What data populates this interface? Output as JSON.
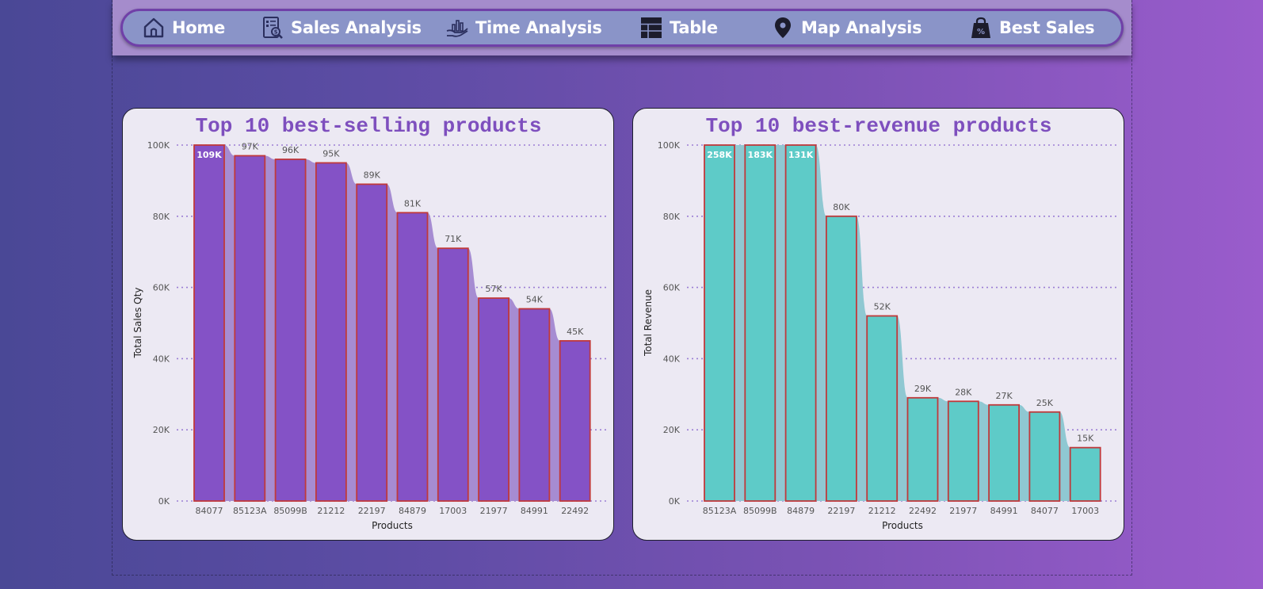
{
  "nav": {
    "items": [
      {
        "label": "Home",
        "icon": "home-icon"
      },
      {
        "label": "Sales Analysis",
        "icon": "sales-report-icon"
      },
      {
        "label": "Time Analysis",
        "icon": "hand-chart-icon"
      },
      {
        "label": "Table",
        "icon": "table-icon"
      },
      {
        "label": "Map Analysis",
        "icon": "map-pin-icon"
      },
      {
        "label": "Best Sales",
        "icon": "discount-bag-icon"
      }
    ]
  },
  "colors": {
    "accent": "#7e4fbe",
    "bar_purple": "#8452c6",
    "bar_teal": "#5ecbc8",
    "bar_outline": "#c0393b",
    "gridline": "#9b7fd4"
  },
  "chart_data": [
    {
      "type": "bar",
      "title": "Top 10 best-selling products",
      "xlabel": "Products",
      "ylabel": "Total Sales Qty",
      "ylim": [
        0,
        100000
      ],
      "yticks": [
        "0K",
        "20K",
        "40K",
        "60K",
        "80K",
        "100K"
      ],
      "grid": true,
      "categories": [
        "84077",
        "85123A",
        "85099B",
        "21212",
        "22197",
        "84879",
        "17003",
        "21977",
        "84991",
        "22492"
      ],
      "values": [
        109000,
        97000,
        96000,
        95000,
        89000,
        81000,
        71000,
        57000,
        54000,
        45000
      ],
      "data_labels": [
        "109K",
        "97K",
        "96K",
        "95K",
        "89K",
        "81K",
        "71K",
        "57K",
        "54K",
        "45K"
      ]
    },
    {
      "type": "bar",
      "title": "Top 10 best-revenue products",
      "xlabel": "Products",
      "ylabel": "Total Revenue",
      "ylim": [
        0,
        100000
      ],
      "yticks": [
        "0K",
        "20K",
        "40K",
        "60K",
        "80K",
        "100K"
      ],
      "grid": true,
      "categories": [
        "85123A",
        "85099B",
        "84879",
        "22197",
        "21212",
        "22492",
        "21977",
        "84991",
        "84077",
        "17003"
      ],
      "values": [
        258000,
        183000,
        131000,
        80000,
        52000,
        29000,
        28000,
        27000,
        25000,
        15000
      ],
      "data_labels": [
        "258K",
        "183K",
        "131K",
        "80K",
        "52K",
        "29K",
        "28K",
        "27K",
        "25K",
        "15K"
      ]
    }
  ]
}
